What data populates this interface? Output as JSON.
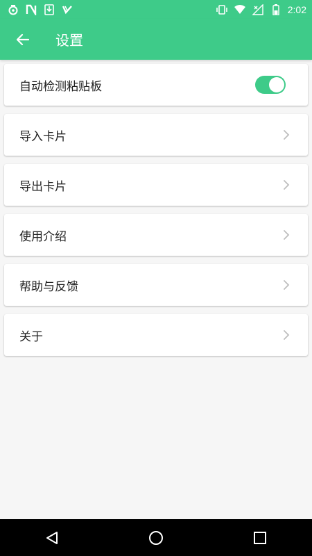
{
  "status_bar": {
    "time": "2:02",
    "left_icons": [
      "sync-app-icon",
      "n-app-icon",
      "download-icon",
      "checkmark-app-icon"
    ],
    "right_icons": [
      "vibrate-icon",
      "wifi-icon",
      "signal-icon",
      "battery-icon"
    ]
  },
  "app_bar": {
    "title": "设置",
    "back_icon": "arrow-left-icon",
    "color": "#3ecb89"
  },
  "settings": {
    "auto_detect": {
      "label": "自动检测粘贴板",
      "enabled": true
    },
    "items": [
      {
        "label": "导入卡片"
      },
      {
        "label": "导出卡片"
      },
      {
        "label": "使用介绍"
      },
      {
        "label": "帮助与反馈"
      },
      {
        "label": "关于"
      }
    ]
  },
  "nav_bar": {
    "buttons": [
      "back-triangle-icon",
      "home-circle-icon",
      "recents-square-icon"
    ]
  }
}
